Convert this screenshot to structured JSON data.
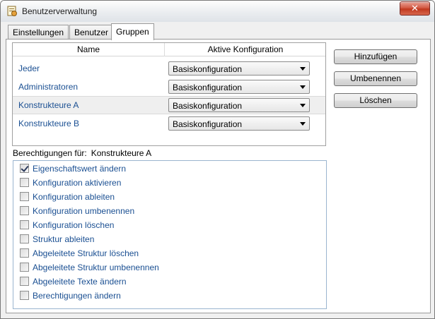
{
  "window": {
    "title": "Benutzerverwaltung",
    "close_label": "✕"
  },
  "tabs": [
    {
      "label": "Einstellungen"
    },
    {
      "label": "Benutzer"
    },
    {
      "label": "Gruppen"
    }
  ],
  "group_list": {
    "columns": [
      "Name",
      "Aktive Konfiguration"
    ],
    "rows": [
      {
        "name": "Jeder",
        "config": "Basiskonfiguration"
      },
      {
        "name": "Administratoren",
        "config": "Basiskonfiguration"
      },
      {
        "name": "Konstrukteure A",
        "config": "Basiskonfiguration"
      },
      {
        "name": "Konstrukteure B",
        "config": "Basiskonfiguration"
      }
    ]
  },
  "buttons": {
    "add": "Hinzufügen",
    "rename": "Umbenennen",
    "delete": "Löschen"
  },
  "permissions": {
    "label": "Berechtigungen für:",
    "group": "Konstrukteure A",
    "items": [
      {
        "label": "Eigenschaftswert ändern",
        "checked": true
      },
      {
        "label": "Konfiguration aktivieren",
        "checked": false
      },
      {
        "label": "Konfiguration ableiten",
        "checked": false
      },
      {
        "label": "Konfiguration umbenennen",
        "checked": false
      },
      {
        "label": "Konfiguration löschen",
        "checked": false
      },
      {
        "label": "Struktur ableiten",
        "checked": false
      },
      {
        "label": "Abgeleitete Struktur löschen",
        "checked": false
      },
      {
        "label": "Abgeleitete Struktur umbenennen",
        "checked": false
      },
      {
        "label": "Abgeleitete Texte ändern",
        "checked": false
      },
      {
        "label": "Berechtigungen ändern",
        "checked": false
      }
    ]
  }
}
